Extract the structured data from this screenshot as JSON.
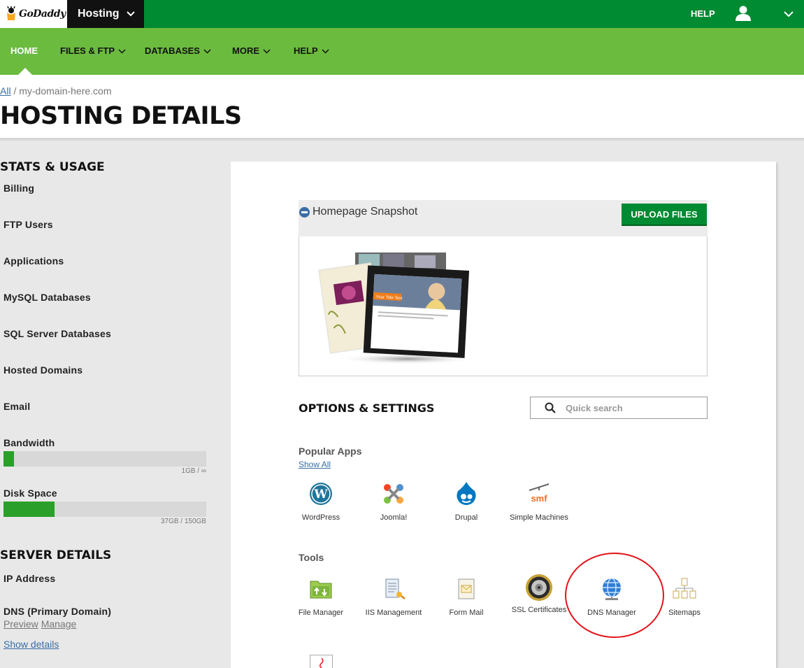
{
  "topbar": {
    "logo_text": "GoDaddy",
    "product": "Hosting",
    "help": "HELP",
    "brand_color": "#008a32"
  },
  "nav": {
    "items": [
      {
        "label": "HOME"
      },
      {
        "label": "FILES & FTP"
      },
      {
        "label": "DATABASES"
      },
      {
        "label": "MORE"
      },
      {
        "label": "HELP"
      }
    ],
    "bar_color": "#6bbb3f"
  },
  "breadcrumb": {
    "root": "All",
    "separator": "/",
    "current": "my-domain-here.com"
  },
  "page_title": "HOSTING DETAILS",
  "sidebar": {
    "stats_heading": "STATS & USAGE",
    "items": [
      "Billing",
      "FTP Users",
      "Applications",
      "MySQL Databases",
      "SQL Server Databases",
      "Hosted Domains",
      "Email"
    ],
    "bandwidth": {
      "label": "Bandwidth",
      "usage": "1GB / ∞",
      "fill_percent": 5
    },
    "disk": {
      "label": "Disk Space",
      "usage": "37GB / 150GB",
      "fill_percent": 25
    },
    "server_heading": "SERVER DETAILS",
    "ip_label": "IP Address",
    "dns_label": "DNS (Primary Domain)",
    "preview_link": "Preview",
    "manage_link": "Manage",
    "show_details": "Show details"
  },
  "snapshot": {
    "title": "Homepage Snapshot",
    "upload_button": "UPLOAD FILES",
    "preview_title": "Your Title Text"
  },
  "options": {
    "title": "OPTIONS & SETTINGS",
    "search_placeholder": "Quick search",
    "popular_label": "Popular Apps",
    "show_all": "Show All",
    "apps": [
      {
        "label": "WordPress",
        "icon": "wordpress-icon"
      },
      {
        "label": "Joomla!",
        "icon": "joomla-icon"
      },
      {
        "label": "Drupal",
        "icon": "drupal-icon"
      },
      {
        "label": "Simple Machines",
        "icon": "smf-icon"
      }
    ],
    "tools_label": "Tools",
    "tools": [
      {
        "label": "File Manager",
        "icon": "folder-icon"
      },
      {
        "label": "IIS Management",
        "icon": "iis-icon"
      },
      {
        "label": "Form Mail",
        "icon": "mail-icon"
      },
      {
        "label": "SSL Certificates",
        "icon": "lock-icon"
      },
      {
        "label": "DNS Manager",
        "icon": "globe-icon"
      },
      {
        "label": "Sitemaps",
        "icon": "sitemap-icon"
      }
    ],
    "highlight_color": "#e4151b"
  }
}
